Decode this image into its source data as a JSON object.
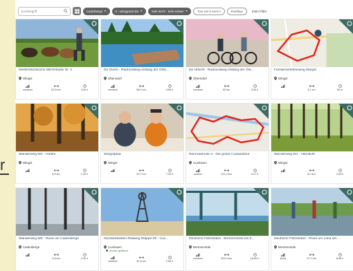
{
  "filters": {
    "search_placeholder": "Suchbegriff",
    "region": "Cadenberge",
    "distance": "0 - unbegrenzt km",
    "difficulty": "Sehr leicht - Sehr schwer",
    "duration": "Tour von 0 nach 0",
    "roundtour": "Rundtour",
    "my_filter": "mein Filter"
  },
  "side_text": "r",
  "cards": [
    {
      "title": "Niedersächsische Milchstraße Nr. 3",
      "location": "Wingst",
      "difficulty": "medium",
      "distance": "51,5 km",
      "duration": "3:30 h",
      "image": "cows"
    },
    {
      "title": "De Övers - Radrundweg entlang der Oste...",
      "location": "Oberndorf",
      "difficulty": "medium",
      "distance": "58,4 km",
      "duration": "3:55 h",
      "image": "lake"
    },
    {
      "title": "De Utsicht - Radrundweg entlang der Ost...",
      "location": "Oberndorf",
      "difficulty": "medium",
      "distance": "52 km",
      "duration": "3:30 h",
      "image": "cyclists"
    },
    {
      "title": "Familienerlebnisweg Wingst",
      "location": "Wingst",
      "difficulty": "",
      "distance": "3,1 km",
      "duration": "50 m",
      "image": "map1"
    },
    {
      "title": "Wanderweg W2 - Hüden",
      "location": "Wingst",
      "difficulty": "",
      "distance": "6,5 km",
      "duration": "1:40 h",
      "image": "forest"
    },
    {
      "title": "Wingstpfad",
      "location": "Wingst",
      "difficulty": "",
      "distance": "30,7 km",
      "duration": "7:33 h",
      "image": "people"
    },
    {
      "title": "Rennradroute 3 - Die große Cuxlandtour",
      "location": "Cuxhaven",
      "difficulty": "schwer",
      "distance": "121,4 km",
      "duration": "4:17 h",
      "image": "map2"
    },
    {
      "title": "Wanderweg W1 - Altenfluth",
      "location": "Wingst",
      "difficulty": "",
      "distance": "8,2 km",
      "duration": "2:03 h",
      "image": "trees"
    },
    {
      "title": "Wanderweg W6 - Rund um Cadenberge",
      "location": "Cadenberge",
      "difficulty": "",
      "distance": "9,8 km",
      "duration": "2:30 h",
      "image": "birches"
    },
    {
      "title": "Nordseeküsten-Radweg Etappe 09 - Cux...",
      "location": "Cuxhaven",
      "status": "Immer geöffnet",
      "difficulty": "medium",
      "distance": "40,5 km",
      "duration": "2:50 h",
      "image": "kugelbake"
    },
    {
      "title": "Deutsche Fährstraße - Bremervörde bis K...",
      "location": "Bremervörde",
      "difficulty": "medium",
      "distance": "209,3 km",
      "duration": "18:00 h",
      "image": "bridge"
    },
    {
      "title": "Deutsche Fährstraße - Rund um Land am ...",
      "location": "Bremervörde",
      "difficulty": "leicht",
      "distance": "97,1 km",
      "duration": "6:55 h",
      "image": "canal"
    }
  ]
}
